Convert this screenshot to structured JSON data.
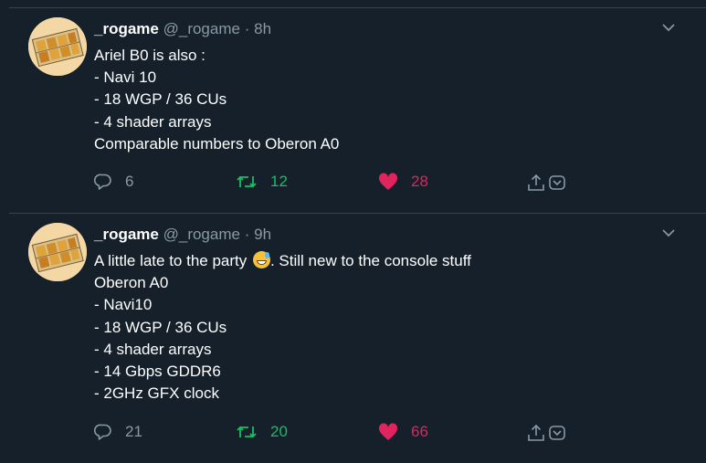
{
  "tweets": [
    {
      "name": "_rogame",
      "handle": "@_rogame",
      "dot": "·",
      "time": "8h",
      "lines": [
        "Ariel B0 is also :",
        "- Navi 10",
        "- 18 WGP / 36 CUs",
        "- 4 shader arrays",
        "Comparable numbers to Oberon A0"
      ],
      "replies": "6",
      "retweets": "12",
      "likes": "28"
    },
    {
      "name": "_rogame",
      "handle": "@_rogame",
      "dot": "·",
      "time": "9h",
      "first_line_before_emoji": "A little late to the party ",
      "emoji": "sweat-smile-emoji",
      "first_line_after_emoji": ". Still new to the console stuff",
      "lines": [
        "Oberon A0",
        "- Navi10",
        "- 18 WGP / 36 CUs",
        "- 4 shader arrays",
        "- 14 Gbps GDDR6",
        "- 2GHz GFX clock"
      ],
      "replies": "21",
      "retweets": "20",
      "likes": "66"
    }
  ],
  "colors": {
    "background": "#15202b",
    "muted": "#8899a6",
    "retweet": "#17bf63",
    "like": "#e0245e",
    "divider": "#38444d"
  },
  "icons": [
    "reply-icon",
    "retweet-icon",
    "like-icon",
    "share-icon",
    "bookmark-icon",
    "chevron-down-icon"
  ]
}
